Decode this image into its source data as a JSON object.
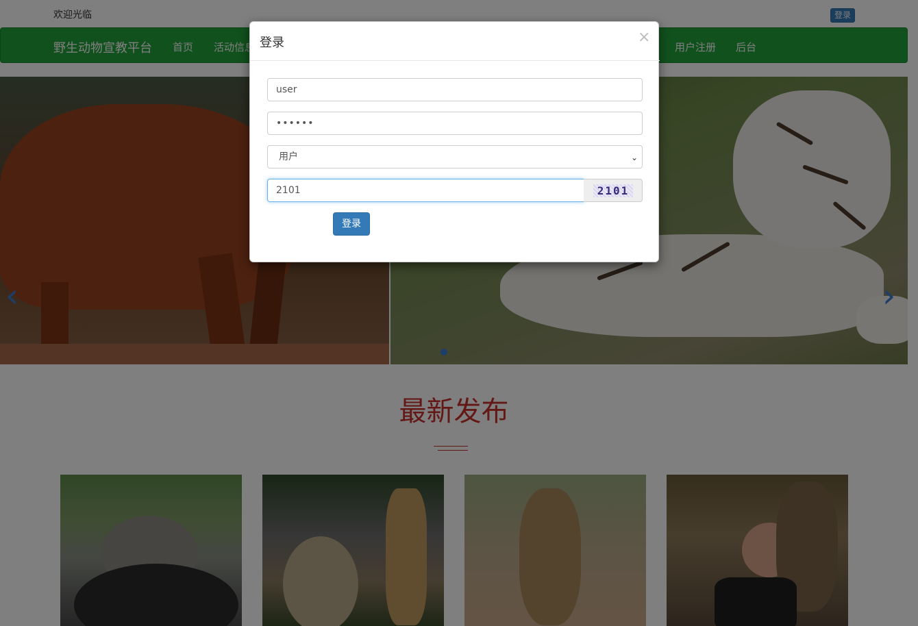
{
  "header": {
    "welcome_text": "欢迎光临",
    "login_button": "登录"
  },
  "nav": {
    "brand": "野生动物宣教平台",
    "items": [
      {
        "label": "首页"
      },
      {
        "label": "活动信息"
      },
      {
        "label": "用户注册"
      },
      {
        "label": "后台"
      }
    ]
  },
  "carousel": {
    "prev_icon": "chevron-left-icon",
    "next_icon": "chevron-right-icon",
    "prev_glyph": "‹",
    "next_glyph": "›"
  },
  "section": {
    "title": "最新发布"
  },
  "modal": {
    "title": "登录",
    "close_glyph": "×",
    "username_value": "user",
    "password_value": "••••••",
    "role_selected": "用户",
    "captcha_input_value": "2101",
    "captcha_image_text": "2101",
    "submit_label": "登录"
  },
  "colors": {
    "nav_bg": "#23a23a",
    "primary": "#337ab7",
    "section_title": "#c8312c",
    "backdrop": "rgba(0,0,0,0.5)"
  }
}
